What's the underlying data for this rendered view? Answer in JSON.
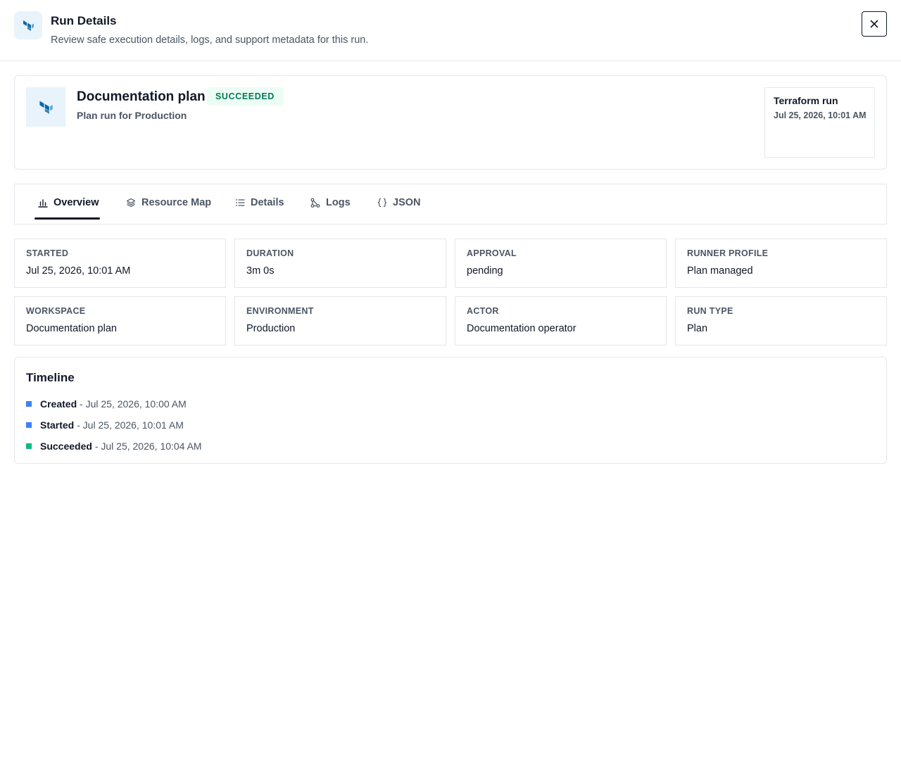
{
  "header": {
    "title": "Run Details",
    "subtitle": "Review safe execution details, logs, and support metadata for this run.",
    "close_icon": "close-icon",
    "logo_icon": "terraform-logo-icon"
  },
  "summary": {
    "title": "Documentation plan",
    "status": "SUCCEEDED",
    "subtitle": "Plan run for Production",
    "run_box": {
      "title": "Terraform run",
      "date": "Jul 25, 2026, 10:01 AM"
    }
  },
  "tabs": [
    {
      "label": "Overview",
      "icon": "bar-chart-icon",
      "active": true
    },
    {
      "label": "Resource Map",
      "icon": "layers-icon",
      "active": false
    },
    {
      "label": "Details",
      "icon": "list-icon",
      "active": false
    },
    {
      "label": "Logs",
      "icon": "git-branch-icon",
      "active": false
    },
    {
      "label": "JSON",
      "icon": "braces-icon",
      "active": false
    }
  ],
  "stats": [
    {
      "label": "STARTED",
      "value": "Jul 25, 2026, 10:01 AM"
    },
    {
      "label": "DURATION",
      "value": "3m 0s"
    },
    {
      "label": "APPROVAL",
      "value": "pending"
    },
    {
      "label": "RUNNER PROFILE",
      "value": "Plan managed"
    },
    {
      "label": "WORKSPACE",
      "value": "Documentation plan"
    },
    {
      "label": "ENVIRONMENT",
      "value": "Production"
    },
    {
      "label": "ACTOR",
      "value": "Documentation operator"
    },
    {
      "label": "RUN TYPE",
      "value": "Plan"
    }
  ],
  "timeline": {
    "title": "Timeline",
    "items": [
      {
        "name": "Created",
        "time": " - Jul 25, 2026, 10:00 AM",
        "color": "#3b82f6"
      },
      {
        "name": "Started",
        "time": " - Jul 25, 2026, 10:01 AM",
        "color": "#3b82f6"
      },
      {
        "name": "Succeeded",
        "time": " - Jul 25, 2026, 10:04 AM",
        "color": "#10b981"
      }
    ]
  },
  "colors": {
    "brand": "#0b6aa8",
    "success_bg": "#ecfdf5",
    "success_text": "#047857"
  }
}
